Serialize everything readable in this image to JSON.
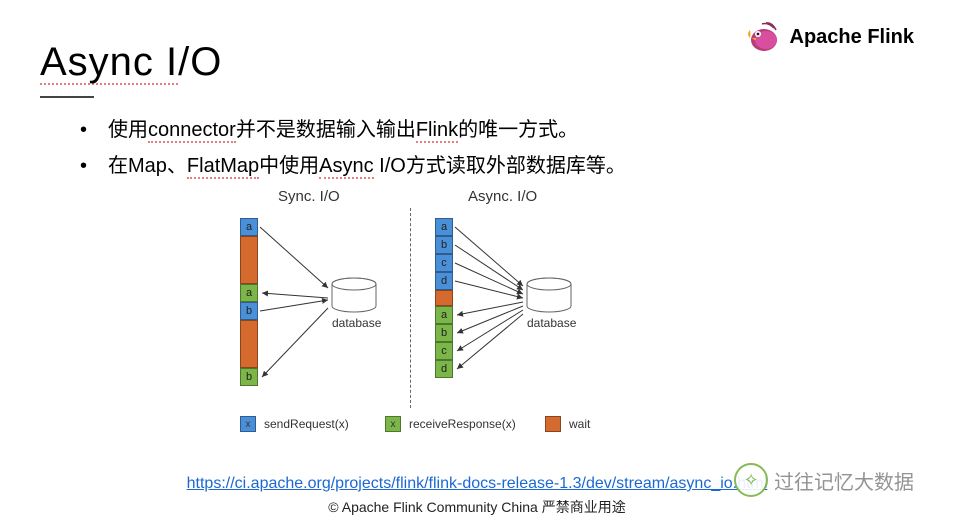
{
  "brand": "Apache Flink",
  "title_plain": "Async I",
  "title_slash_o": "/O",
  "bullets": [
    {
      "pre": "使用",
      "w1": "connector",
      "mid1": "并不是数据输入输出",
      "w2": "Flink",
      "post": "的唯一方式。"
    },
    {
      "pre": "在Map、",
      "w1": "FlatMap",
      "mid1": "中使用",
      "w2": "Async",
      "mid2": " I/O方式读取外部数据库等。"
    }
  ],
  "diagram": {
    "sync_label": "Sync. I/O",
    "async_label": "Async. I/O",
    "db_label": "database",
    "sync_queue": [
      "a",
      "wait",
      "a",
      "b",
      "wait",
      "b"
    ],
    "async_send": [
      "a",
      "b",
      "c",
      "d"
    ],
    "async_wait": true,
    "async_recv": [
      "a",
      "b",
      "c",
      "d"
    ]
  },
  "legend": {
    "send": {
      "letter": "x",
      "label": "sendRequest(x)"
    },
    "recv": {
      "letter": "x",
      "label": "receiveResponse(x)"
    },
    "wait": {
      "label": "wait"
    }
  },
  "link_text": "https://ci.apache.org/projects/flink/flink-docs-release-1.3/dev/stream/async_io.html",
  "link_href": "https://ci.apache.org/projects/flink/flink-docs-release-1.3/dev/stream/async_io.html",
  "footer": "© Apache Flink Community China  严禁商业用途",
  "watermark": "过往记忆大数据",
  "colors": {
    "blue": "#4a90d9",
    "green": "#7ab648",
    "orange": "#d46a2e"
  }
}
